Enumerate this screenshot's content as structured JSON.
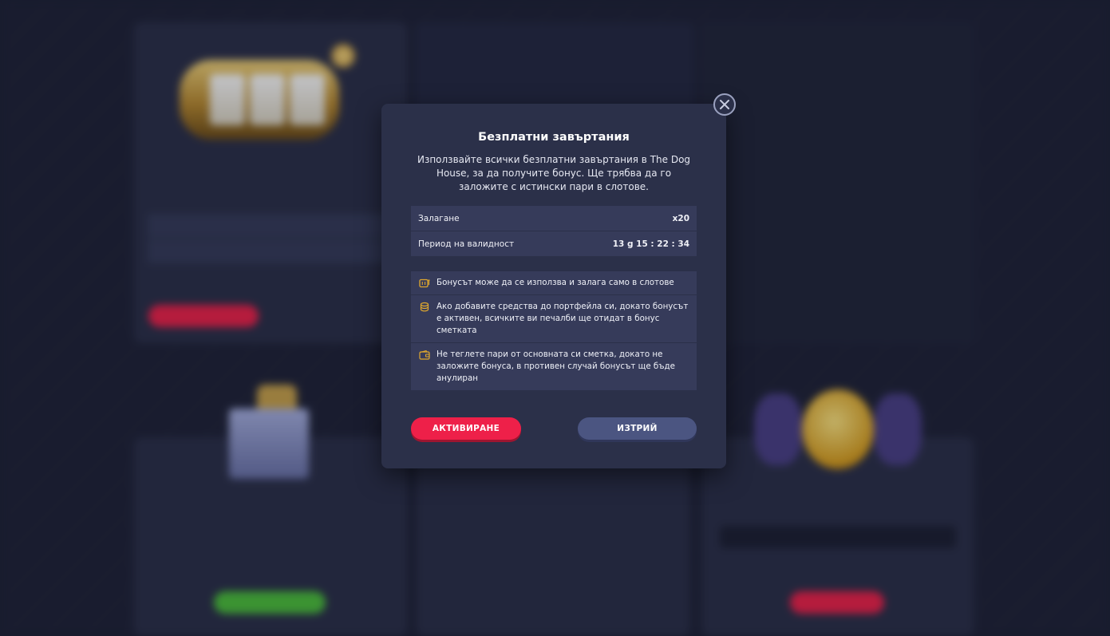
{
  "modal": {
    "title": "Безплатни завъртания",
    "description": "Използвайте всички безплатни завъртания в The Dog House, за да получите бонус. Ще трябва да го заложите с истински пари в слотове.",
    "info_rows": [
      {
        "label": "Залагане",
        "value": "x20"
      },
      {
        "label": "Период на валидност",
        "value": "13 g 15 : 22 : 34"
      }
    ],
    "rules": [
      {
        "icon": "slot-machine-icon",
        "text": "Бонусът може да се използва и залага само в слотове"
      },
      {
        "icon": "coins-icon",
        "text": "Ако добавите средства до портфейла си, докато бонусът е активен, всичките ви печалби ще отидат в бонус сметката"
      },
      {
        "icon": "wallet-icon",
        "text": "Не теглете пари от основната си сметка, докато не заложите бонуса, в противен случай бонусът ще бъде анулиран"
      }
    ],
    "activate_label": "АКТИВИРАНЕ",
    "delete_label": "ИЗТРИЙ"
  },
  "colors": {
    "accent_red": "#ee2049",
    "button_secondary": "#4b5581",
    "modal_bg": "#2b3049",
    "icon_gold": "#e0a82e"
  }
}
